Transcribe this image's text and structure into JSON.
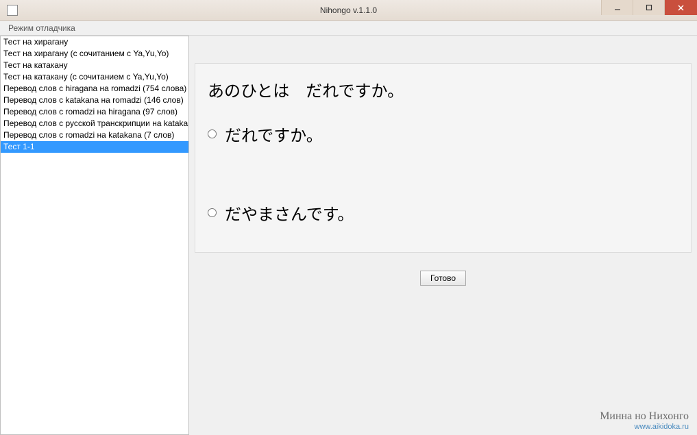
{
  "window": {
    "title": "Nihongo v.1.1.0"
  },
  "menubar": {
    "debugger": "Режим отладчика"
  },
  "sidebar": {
    "items": [
      "Тест на хирагану",
      "Тест на хирагану (с сочитанием с Ya,Yu,Yo)",
      "Тест на катакану",
      "Тест на катакану (с сочитанием с Ya,Yu,Yo)",
      "Перевод слов с hiragana на romadzi (754 слова)",
      "Перевод слов с katakana на romadzi (146 слов)",
      "Перевод слов с romadzi на hiragana (97 слов)",
      "Перевод слов с русской транскрипции на katakana",
      "Перевод слов с romadzi на katakana (7 слов)",
      "Тест 1-1"
    ],
    "selected_index": 9
  },
  "quiz": {
    "question": "あのひとは　だれですか。",
    "options": [
      "だれですか。",
      "だやまさんです。"
    ],
    "submit_label": "Готово"
  },
  "footer": {
    "brand": "Минна но Нихонго",
    "url": "www.aikidoka.ru"
  }
}
